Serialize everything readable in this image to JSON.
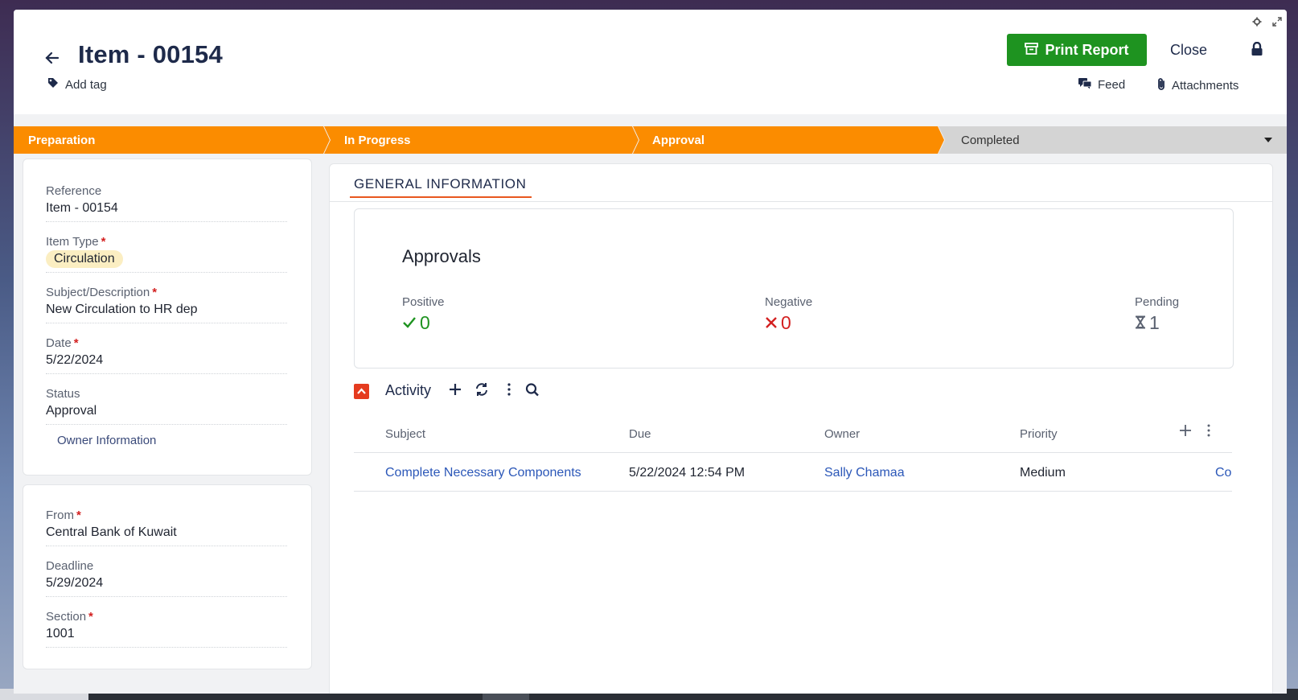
{
  "header": {
    "title": "Item - 00154",
    "add_tag_label": "Add tag",
    "print_report_label": "Print Report",
    "close_label": "Close",
    "feed_label": "Feed",
    "attachments_label": "Attachments"
  },
  "stages": [
    {
      "label": "Preparation",
      "state": "done"
    },
    {
      "label": "In Progress",
      "state": "done"
    },
    {
      "label": "Approval",
      "state": "done"
    },
    {
      "label": "Completed",
      "state": "todo"
    }
  ],
  "fields_main": {
    "reference": {
      "label": "Reference",
      "value": "Item - 00154"
    },
    "item_type": {
      "label": "Item Type",
      "value": "Circulation",
      "required": "*"
    },
    "subject": {
      "label": "Subject/Description",
      "value": "New Circulation to HR dep",
      "required": "*"
    },
    "date": {
      "label": "Date",
      "value": "5/22/2024",
      "required": "*"
    },
    "status": {
      "label": "Status",
      "value": "Approval"
    },
    "owner_information_label": "Owner Information"
  },
  "fields_origin": {
    "from": {
      "label": "From",
      "value": "Central Bank of Kuwait",
      "required": "*"
    },
    "deadline": {
      "label": "Deadline",
      "value": "5/29/2024"
    },
    "section": {
      "label": "Section",
      "value": "1001",
      "required": "*"
    }
  },
  "tabs": {
    "general_information": "GENERAL INFORMATION"
  },
  "approvals": {
    "title": "Approvals",
    "positive": {
      "label": "Positive",
      "value": "0"
    },
    "negative": {
      "label": "Negative",
      "value": "0"
    },
    "pending": {
      "label": "Pending",
      "value": "1"
    }
  },
  "activity": {
    "title": "Activity",
    "columns": [
      "Subject",
      "Due",
      "Owner",
      "Priority"
    ],
    "rows": [
      {
        "subject": "Complete Necessary Components",
        "due": "5/22/2024 12:54 PM",
        "owner": "Sally Chamaa",
        "priority": "Medium",
        "extra": "Co"
      }
    ]
  },
  "colors": {
    "stage_done": "#fb8c00",
    "stage_todo": "#d4d4d4",
    "print_button": "#1e9320",
    "positive": "#1e9320",
    "negative": "#d32020",
    "link": "#2b57b8",
    "tab_underline": "#e8571f"
  },
  "icons": [
    "back-arrow-icon",
    "tag-icon",
    "archive-icon",
    "lock-icon",
    "feed-icon",
    "paperclip-icon",
    "gear-icon",
    "expand-icon",
    "chevron-down-icon",
    "check-icon",
    "cross-icon",
    "hourglass-icon",
    "chevron-up-icon",
    "plus-icon",
    "refresh-icon",
    "kebab-icon",
    "search-icon"
  ]
}
